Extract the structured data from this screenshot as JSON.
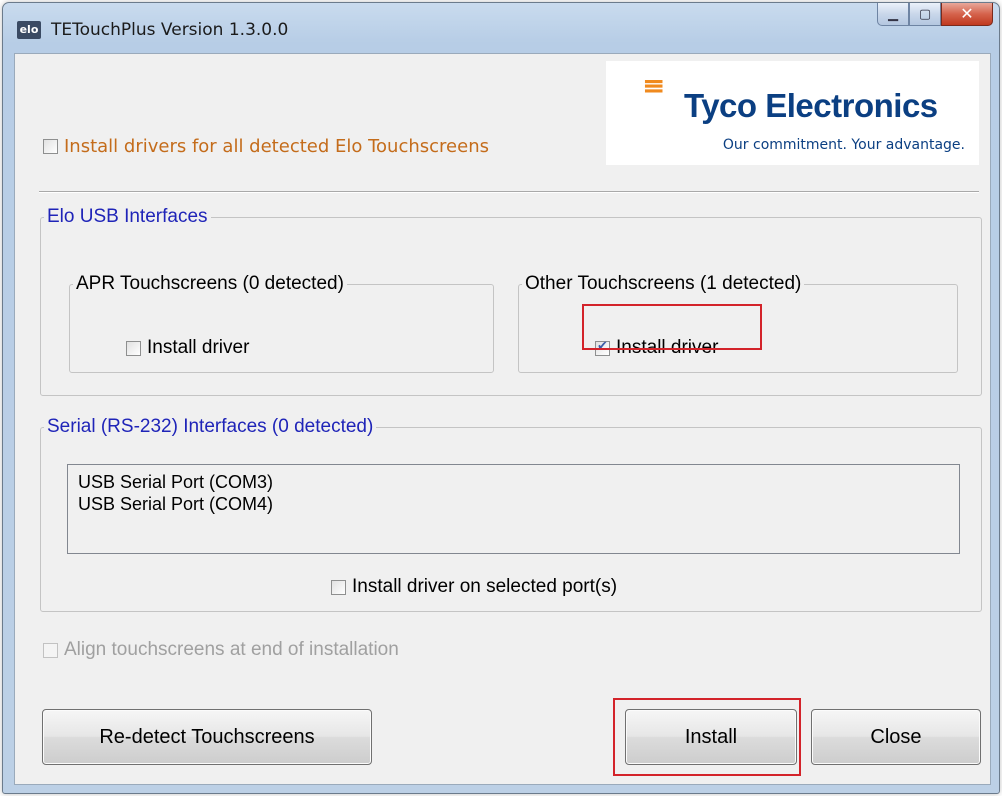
{
  "window": {
    "title": "TETouchPlus Version 1.3.0.0",
    "icon_text": "elo"
  },
  "caption": {
    "minimize": "▁",
    "maximize": "▢",
    "close": "✕"
  },
  "top": {
    "install_all_label": "Install drivers for all detected Elo Touchscreens",
    "install_all_checked": false
  },
  "logo": {
    "mark": "≡",
    "name": "Tyco Electronics",
    "tagline": "Our commitment. Your advantage."
  },
  "usb": {
    "legend": "Elo USB Interfaces",
    "apr": {
      "legend": "APR Touchscreens (0 detected)",
      "label": "Install driver",
      "checked": false
    },
    "other": {
      "legend": "Other Touchscreens (1 detected)",
      "label": "Install driver",
      "checked": true
    }
  },
  "serial": {
    "legend": "Serial (RS-232) Interfaces (0 detected)",
    "ports": [
      "USB Serial Port (COM3)",
      "USB Serial Port (COM4)"
    ],
    "install_label": "Install driver on selected port(s)",
    "install_checked": false
  },
  "align": {
    "label": "Align touchscreens at end of installation",
    "enabled": false
  },
  "buttons": {
    "redetect": "Re-detect Touchscreens",
    "install": "Install",
    "close": "Close"
  },
  "colors": {
    "highlight": "#d3232a",
    "legend_blue": "#1f24b8",
    "orange_text": "#c46c1b",
    "logo_blue": "#0b3f82",
    "logo_orange": "#f08a1e"
  }
}
